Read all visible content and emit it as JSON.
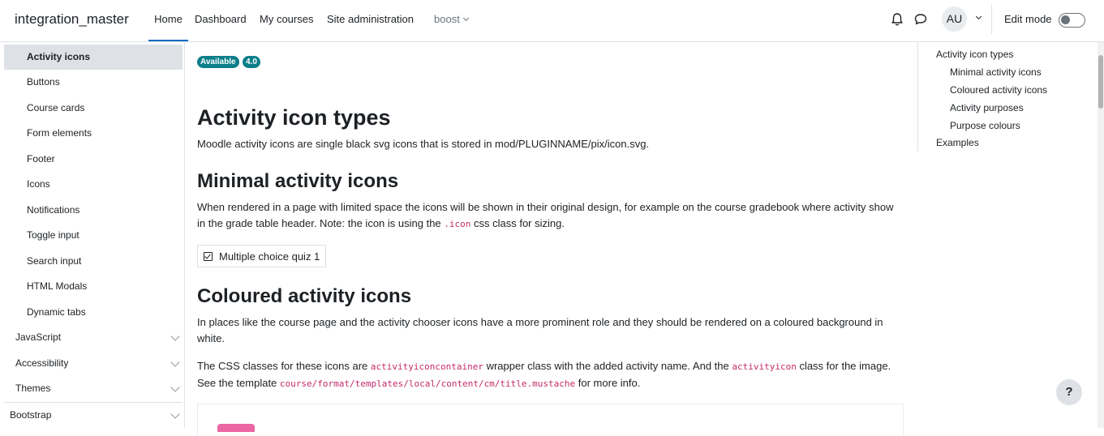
{
  "navbar": {
    "site_name": "integration_master",
    "items": [
      {
        "label": "Home"
      },
      {
        "label": "Dashboard"
      },
      {
        "label": "My courses"
      },
      {
        "label": "Site administration"
      },
      {
        "label": "boost"
      }
    ],
    "user_initials": "AU",
    "edit_mode_label": "Edit mode",
    "edit_mode_on": false
  },
  "drawer": {
    "items": [
      {
        "label": "Activity icons",
        "active": true
      },
      {
        "label": "Buttons"
      },
      {
        "label": "Course cards"
      },
      {
        "label": "Form elements"
      },
      {
        "label": "Footer"
      },
      {
        "label": "Icons"
      },
      {
        "label": "Notifications"
      },
      {
        "label": "Toggle input"
      },
      {
        "label": "Search input"
      },
      {
        "label": "HTML Modals"
      },
      {
        "label": "Dynamic tabs"
      }
    ],
    "sections": [
      {
        "label": "JavaScript"
      },
      {
        "label": "Accessibility"
      },
      {
        "label": "Themes"
      },
      {
        "label": "Bootstrap"
      }
    ]
  },
  "main": {
    "badges": [
      "Available",
      "4.0"
    ],
    "heading": "Activity icon types",
    "intro": "Moodle activity icons are single black svg icons that is stored in mod/PLUGINNAME/pix/icon.svg.",
    "minimal": {
      "heading": "Minimal activity icons",
      "text_before": "When rendered in a page with limited space the icons will be shown in their original design, for example on the course gradebook where activity show in the grade table header. Note: the icon is using the ",
      "code": ".icon",
      "text_after": " css class for sizing.",
      "example_label": "Multiple choice quiz 1"
    },
    "coloured": {
      "heading": "Coloured activity icons",
      "text1": "In places like the course page and the activity chooser icons have a more prominent role and they should be rendered on a coloured background in white.",
      "text2_a": "The CSS classes for these icons are ",
      "code1": "activityiconcontainer",
      "text2_b": " wrapper class with the added activity name. And the ",
      "code2": "activityicon",
      "text2_c": " class for the image. See the template ",
      "code3": "course/format/templates/local/content/cm/title.mustache",
      "text2_d": " for more info."
    }
  },
  "toc": {
    "items": [
      {
        "label": "Activity icon types",
        "level": 1
      },
      {
        "label": "Minimal activity icons",
        "level": 2
      },
      {
        "label": "Coloured activity icons",
        "level": 2
      },
      {
        "label": "Activity purposes",
        "level": 2
      },
      {
        "label": "Purpose colours",
        "level": 2
      },
      {
        "label": "Examples",
        "level": 1
      }
    ]
  },
  "help_label": "?",
  "colors": {
    "brand": "#0f6cbf",
    "badge": "#0b7e8a",
    "code": "#c42a6b",
    "chip": "#eb66a2"
  }
}
